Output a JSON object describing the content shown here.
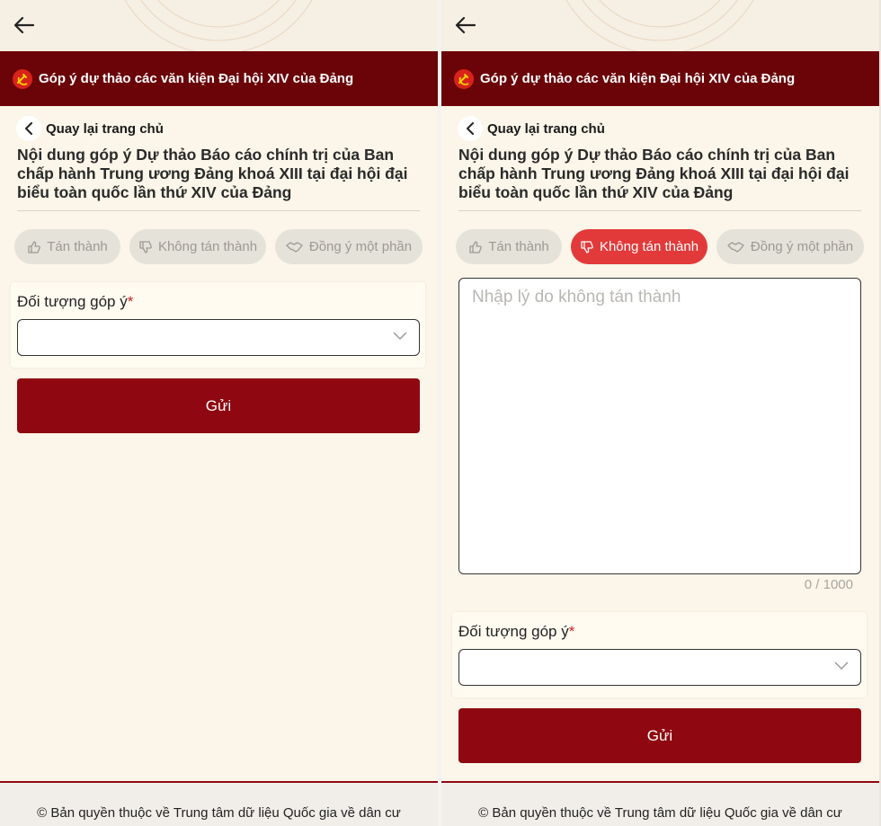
{
  "banner": {
    "title": "Góp ý dự thảo các văn kiện Đại hội XIV của Đảng"
  },
  "nav": {
    "back_home": "Quay lại trang chủ"
  },
  "document": {
    "title": "Nội dung góp ý Dự thảo Báo cáo chính trị của Ban chấp hành Trung ương Đảng khoá XIII tại đại hội đại biểu toàn quốc lần thứ XIV của Đảng"
  },
  "vote": {
    "agree": "Tán thành",
    "disagree": "Không tán thành",
    "partial": "Đồng ý một phần"
  },
  "left_screen": {
    "selected_vote": "none"
  },
  "right_screen": {
    "selected_vote": "disagree"
  },
  "form": {
    "target_label": "Đối tượng góp ý",
    "required_mark": "*",
    "target_value": "",
    "reason_placeholder": "Nhập lý do không tán thành",
    "reason_value": "",
    "counter": "0 / 1000",
    "submit_label": "Gửi"
  },
  "footer": {
    "copyright": "© Bản quyền thuộc về Trung tâm dữ liệu Quốc gia về dân cư"
  },
  "colors": {
    "banner_bg": "#6b0408",
    "submit_bg": "#8f0710",
    "active_vote_bg": "#e23a3a",
    "page_bg": "#fbf6e9",
    "inactive_vote_bg": "#e5e2da"
  },
  "icons": {
    "back": "arrow-left-icon",
    "emblem": "hammer-sickle-emblem",
    "agree": "thumbs-up-icon",
    "disagree": "thumbs-down-icon",
    "partial": "handshake-icon",
    "dropdown": "chevron-down-icon"
  }
}
